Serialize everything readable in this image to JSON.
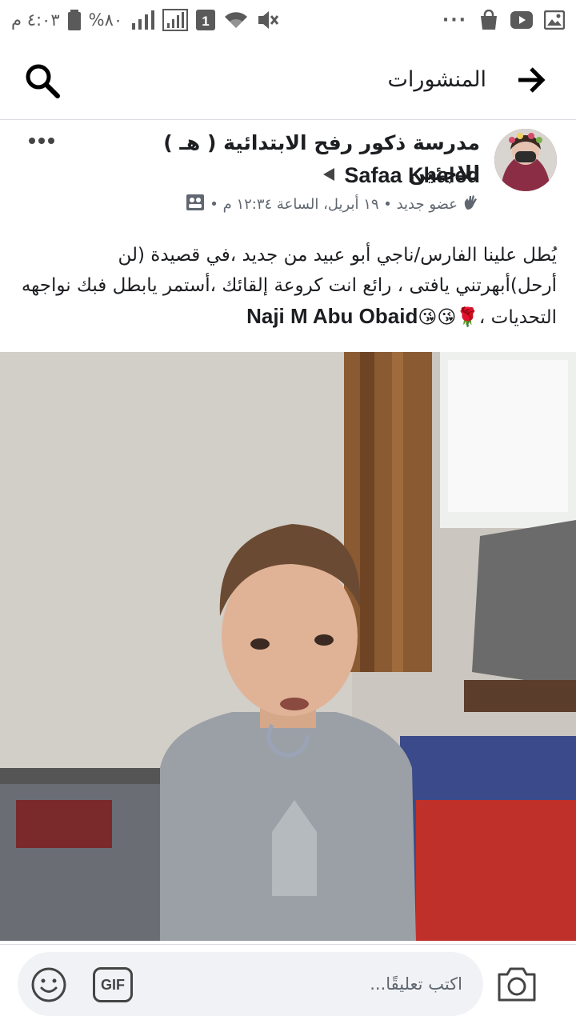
{
  "status_bar": {
    "time": "٤:٠٣ م",
    "battery": "%٨٠",
    "sim_badge": "1",
    "more": "···"
  },
  "header": {
    "title": "المنشورات"
  },
  "post": {
    "group_title": "مدرسة ذكور رفح الابتدائية ( هـ ) للاجئين",
    "author": "Safaa Khaled",
    "meta": "عضو جديد • ١٩ أبريل، الساعة ١٢:٣٤ م •",
    "body_text": "يُطل علينا الفارس/ناجي أبو عبيد من جديد ،في قصيدة (لن أرحل)أبهرتني يافتى ، رائع انت كروعة إلقائك ،أستمر يابطل فبك نواجهه التحديات ،🌹😘😘",
    "mention": "Naji M Abu Obaid"
  },
  "comment_bar": {
    "gif_label": "GIF",
    "placeholder": "اكتب تعليقًا..."
  },
  "icons": {
    "status_right": [
      "photo-icon",
      "youtube-icon",
      "shopping-bag-icon"
    ],
    "status_left": [
      "mute-icon",
      "wifi-icon",
      "sim-icon",
      "signal-icon",
      "signal-icon",
      "battery-icon"
    ],
    "header": [
      "search-icon",
      "back-arrow-icon"
    ],
    "post": [
      "avatar",
      "more-icon",
      "wave-icon",
      "photo-album-icon",
      "play-triangle-icon"
    ],
    "comment": [
      "emoji-icon",
      "gif-icon",
      "camera-icon"
    ]
  },
  "colors": {
    "text": "#1c1e21",
    "secondary_text": "#606770",
    "comment_field": "#f0f2f5",
    "divider": "#dadde1"
  }
}
